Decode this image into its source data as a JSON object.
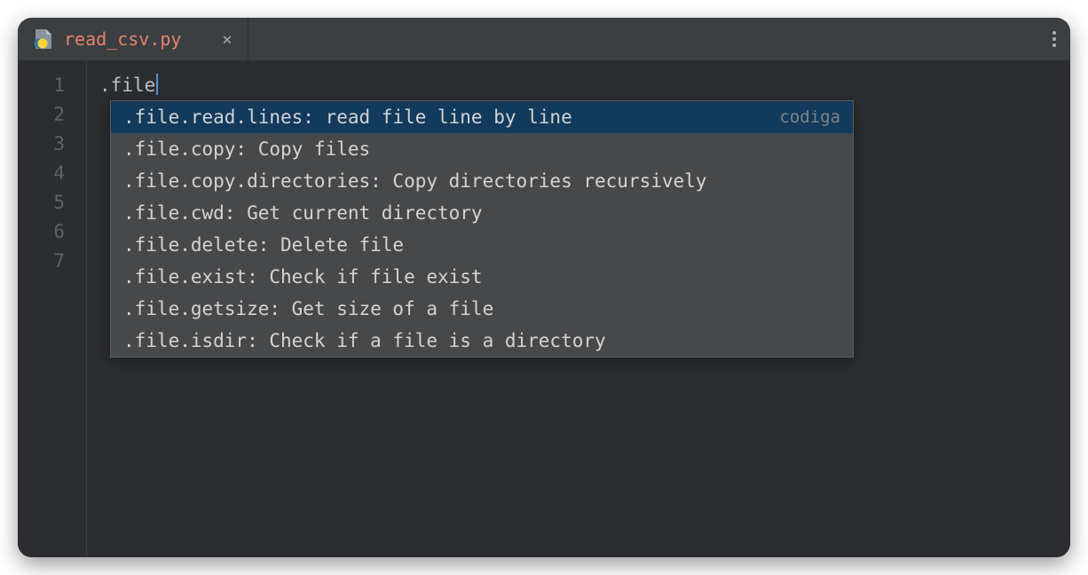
{
  "tab": {
    "filename": "read_csv.py"
  },
  "editor": {
    "line_numbers": [
      "1",
      "2",
      "3",
      "4",
      "5",
      "6",
      "7"
    ],
    "code_line1": ".file"
  },
  "autocomplete": {
    "items": [
      {
        "label": ".file.read.lines: read file line by line",
        "tag": "codiga",
        "selected": true
      },
      {
        "label": ".file.copy: Copy files",
        "tag": "",
        "selected": false
      },
      {
        "label": ".file.copy.directories: Copy directories recursively",
        "tag": "",
        "selected": false
      },
      {
        "label": ".file.cwd: Get current directory",
        "tag": "",
        "selected": false
      },
      {
        "label": ".file.delete: Delete file",
        "tag": "",
        "selected": false
      },
      {
        "label": ".file.exist: Check if file exist",
        "tag": "",
        "selected": false
      },
      {
        "label": ".file.getsize: Get size of a file",
        "tag": "",
        "selected": false
      },
      {
        "label": ".file.isdir: Check if a file is a directory",
        "tag": "",
        "selected": false
      }
    ]
  }
}
